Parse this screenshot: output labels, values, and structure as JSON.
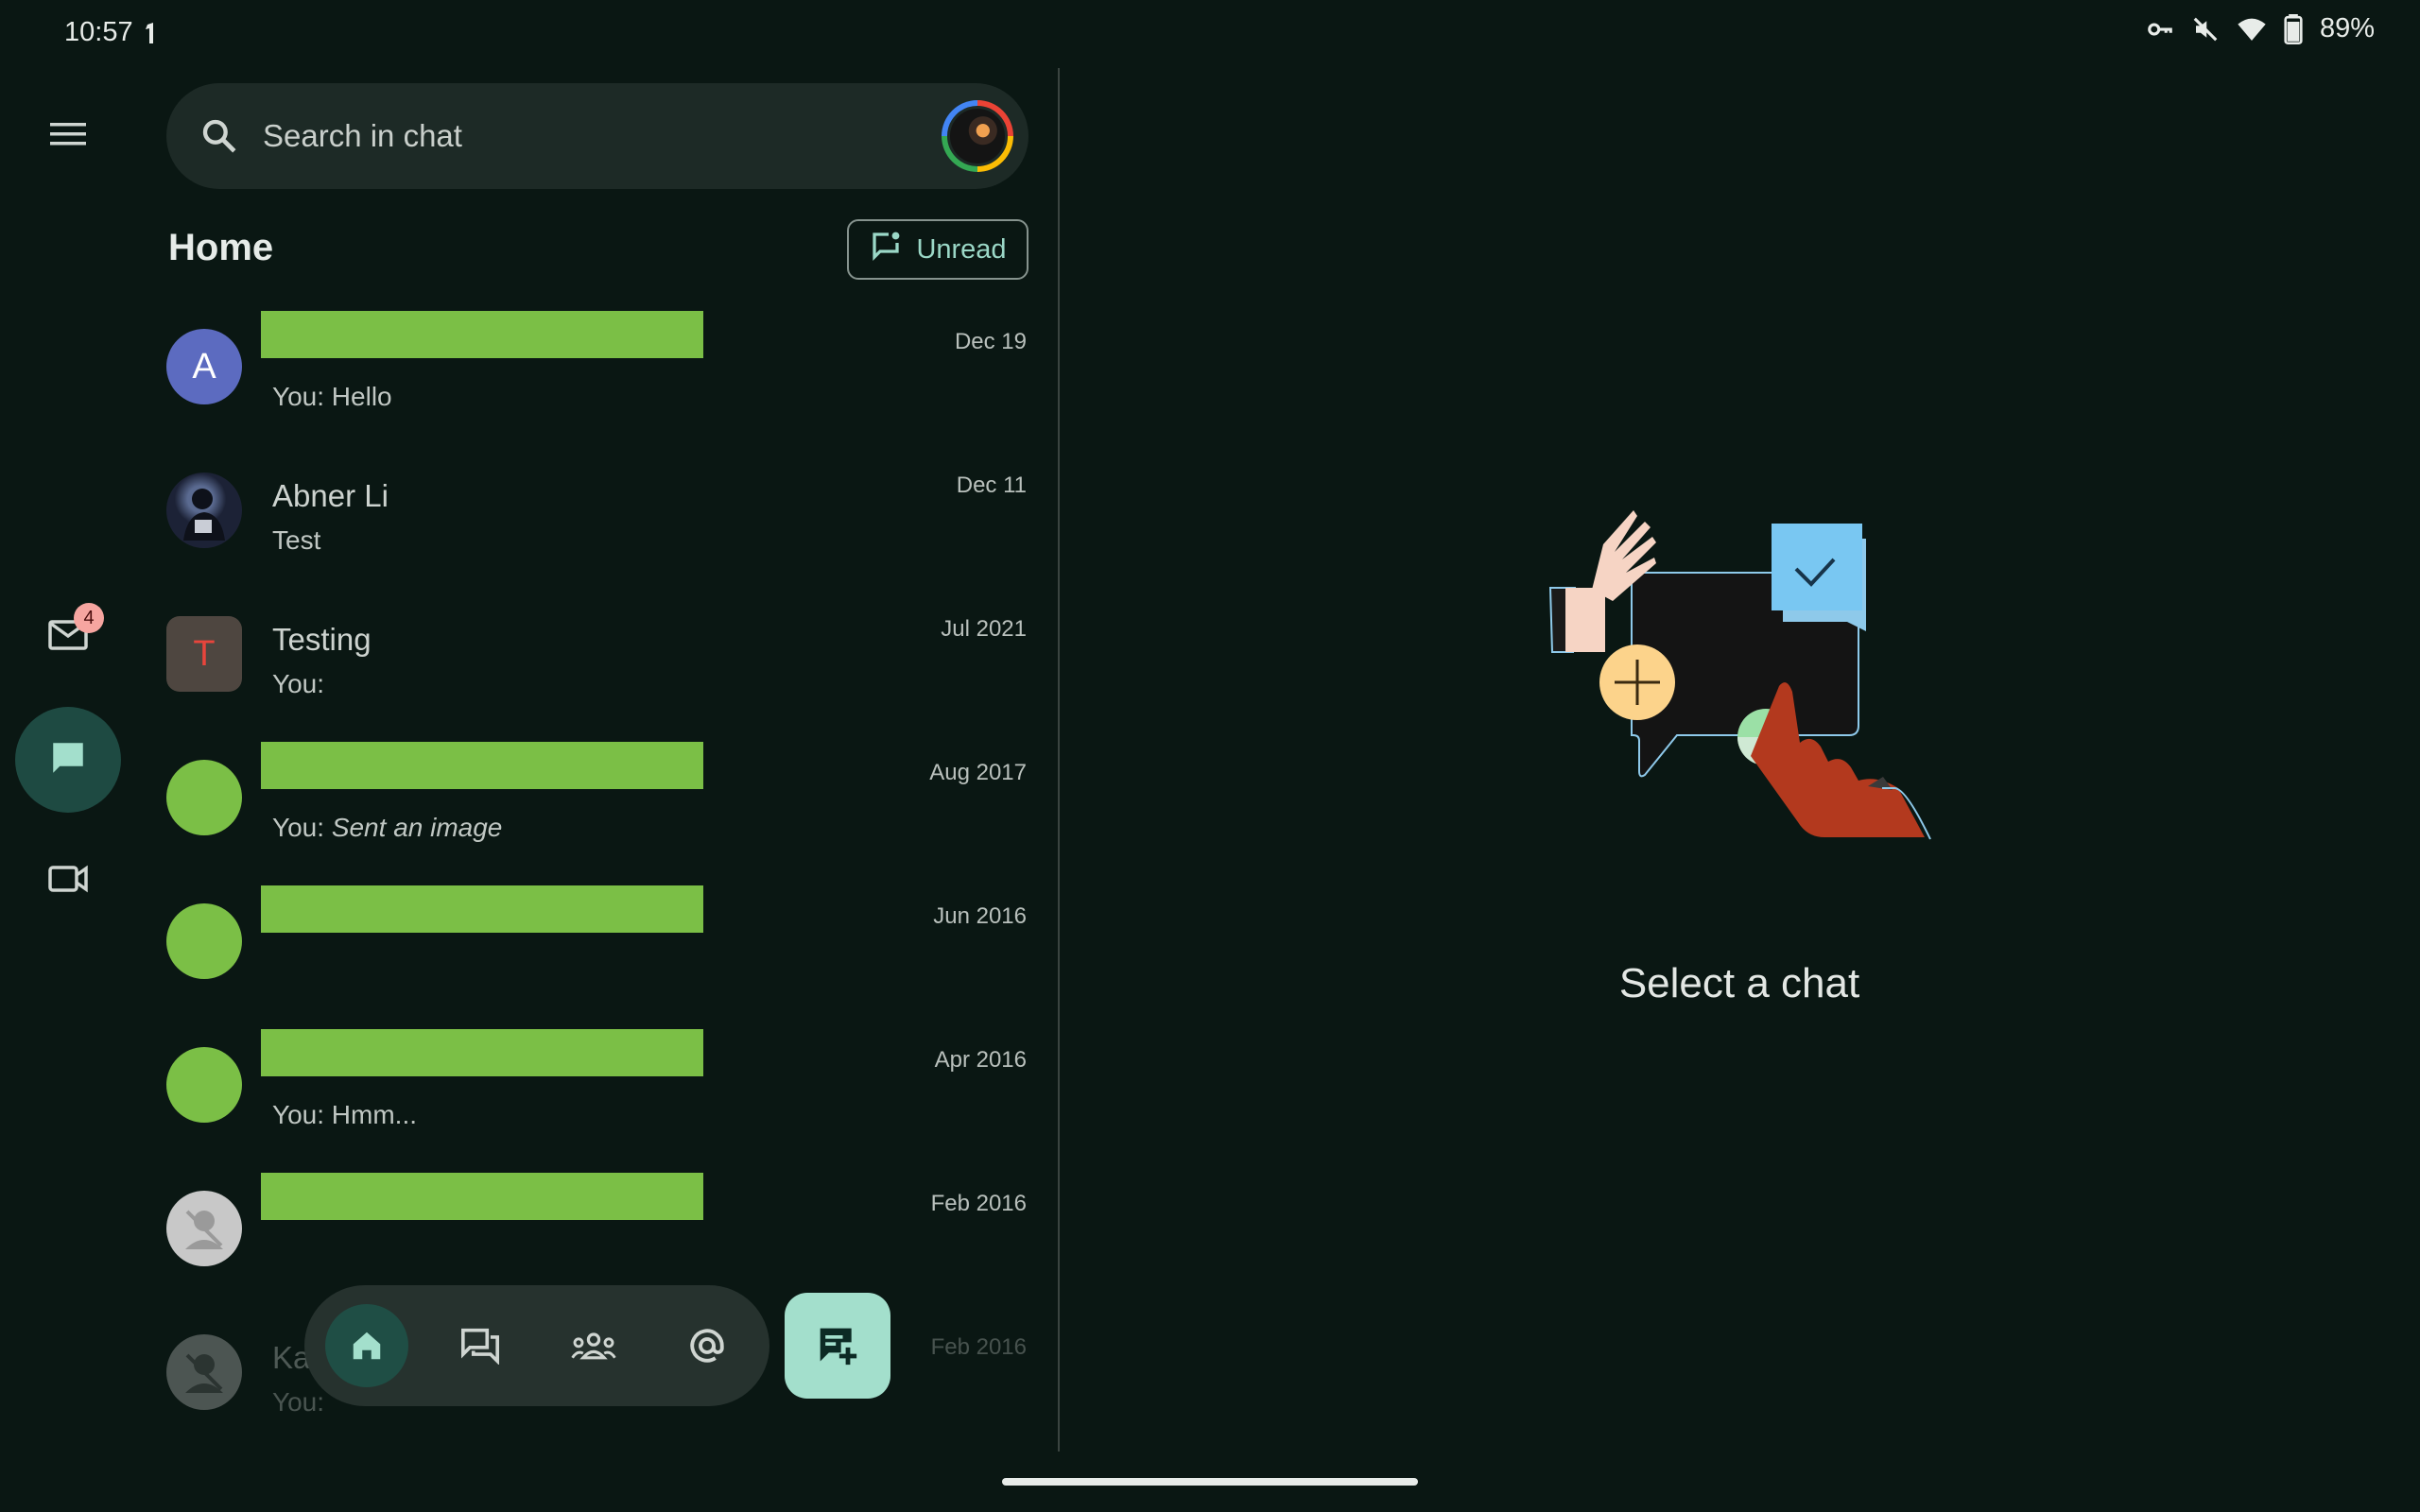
{
  "status_bar": {
    "time": "10:57",
    "battery": "89%"
  },
  "rail": {
    "mail_badge": "4"
  },
  "search": {
    "placeholder": "Search in chat"
  },
  "home": {
    "title": "Home",
    "unread_label": "Unread"
  },
  "chats": [
    {
      "avatar_letter": "A",
      "avatar_color": "#5c6bc0",
      "name": "",
      "name_redacted": true,
      "preview": "You: Hello",
      "date": "Dec 19"
    },
    {
      "avatar_letter": "",
      "avatar_color": "#2b3550",
      "name": "Abner Li",
      "name_redacted": false,
      "preview": "Test",
      "date": "Dec 11"
    },
    {
      "avatar_letter": "T",
      "avatar_color": "#4e4640",
      "name": "Testing",
      "name_redacted": false,
      "preview": "You:",
      "date": "Jul 2021"
    },
    {
      "avatar_letter": "",
      "avatar_color": "#7bbf46",
      "name": "",
      "name_redacted": true,
      "preview_prefix": "You: ",
      "preview_italic": "Sent an image",
      "date": "Aug 2017"
    },
    {
      "avatar_letter": "",
      "avatar_color": "#7bbf46",
      "name": "",
      "name_redacted": true,
      "preview": "",
      "date": "Jun 2016"
    },
    {
      "avatar_letter": "",
      "avatar_color": "#7bbf46",
      "name": "",
      "name_redacted": true,
      "preview": "You: Hmm...",
      "date": "Apr 2016"
    },
    {
      "avatar_letter": "",
      "avatar_color": "#c8c8c8",
      "name": "",
      "name_redacted": true,
      "preview": "",
      "date": "Feb 2016"
    },
    {
      "avatar_letter": "",
      "avatar_color": "#c8c8c8",
      "name": "Ka",
      "name_redacted": false,
      "preview": "You: ",
      "date": "Feb 2016"
    }
  ],
  "empty_state": {
    "text": "Select a chat"
  },
  "icons": [
    "menu-icon",
    "search-icon",
    "mail-icon",
    "chat-icon",
    "video-icon",
    "home-icon",
    "conversations-icon",
    "spaces-icon",
    "mentions-icon",
    "new-chat-icon",
    "key-icon",
    "mute-icon",
    "wifi-icon",
    "battery-icon"
  ],
  "colors": {
    "background": "#0a1713",
    "accent": "#a3dfcc",
    "redaction": "#7bbf46"
  }
}
